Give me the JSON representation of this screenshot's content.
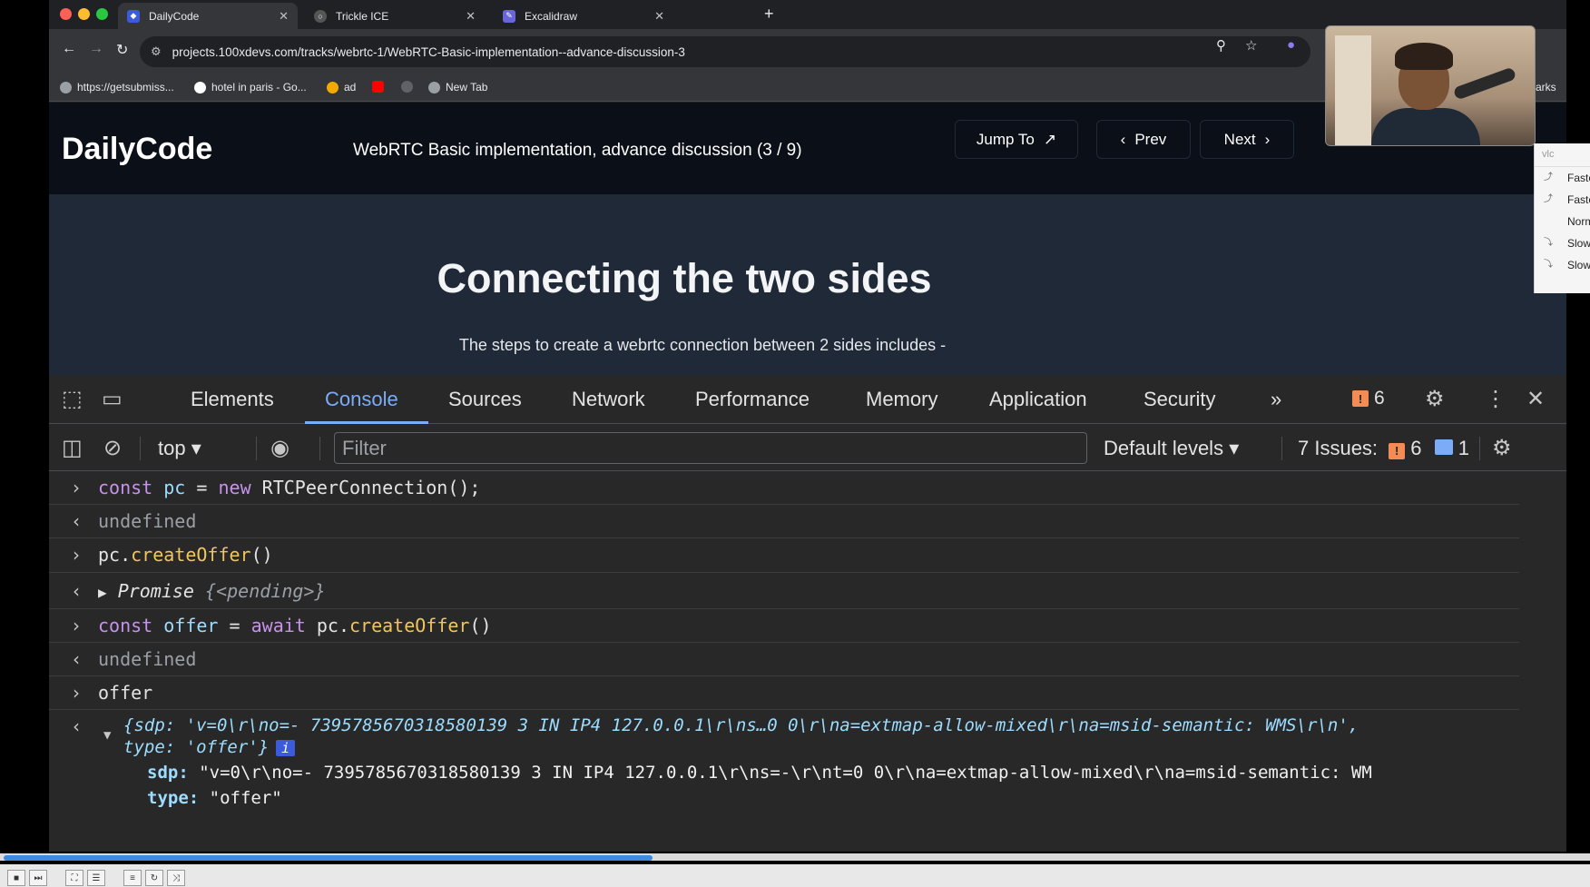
{
  "browser": {
    "tabs": [
      {
        "title": "DailyCode"
      },
      {
        "title": "Trickle ICE"
      },
      {
        "title": "Excalidraw"
      }
    ],
    "url": "projects.100xdevs.com/tracks/webrtc-1/WebRTC-Basic-implementation--advance-discussion-3",
    "bookmarks": [
      {
        "label": "https://getsubmiss..."
      },
      {
        "label": "hotel in paris - Go..."
      },
      {
        "label": "ad"
      },
      {
        "label": "New Tab"
      }
    ],
    "bookmarks_right": "arks"
  },
  "site": {
    "logo": "DailyCode",
    "lesson_title": "WebRTC Basic implementation, advance discussion (3 / 9)",
    "jump_to": "Jump To",
    "prev": "Prev",
    "next": "Next",
    "heading": "Connecting the two sides",
    "paragraph": "The steps to create a webrtc connection between 2 sides includes -"
  },
  "devtools": {
    "tabs": [
      "Elements",
      "Console",
      "Sources",
      "Network",
      "Performance",
      "Memory",
      "Application",
      "Security"
    ],
    "active_tab": "Console",
    "warning_count": "6",
    "context": "top",
    "filter_placeholder": "Filter",
    "levels": "Default levels",
    "issues_label": "7 Issues:",
    "issues_warn": "6",
    "issues_info": "1"
  },
  "console": {
    "l1": {
      "kw": "const",
      "var": "pc",
      "eq": " = ",
      "new": "new",
      "rest": " RTCPeerConnection();"
    },
    "l2": "undefined",
    "l3": {
      "obj": "pc.",
      "fn": "createOffer",
      "rest": "()"
    },
    "l4": {
      "name": "Promise",
      "state": "{<pending>}"
    },
    "l5": {
      "kw": "const",
      "var": "offer",
      "eq": " = ",
      "await": "await",
      "obj": " pc.",
      "fn": "createOffer",
      "rest": "()"
    },
    "l6": "undefined",
    "l7": "offer",
    "l8a": "{sdp: 'v=0\\r\\no=- 7395785670318580139 3 IN IP4 127.0.0.1\\r\\ns…0 0\\r\\na=extmap-allow-mixed\\r\\na=msid-semantic: WMS\\r\\n',",
    "l8b": "type: 'offer'}",
    "info_chip": "i",
    "l9_key": "sdp:",
    "l9_val": " \"v=0\\r\\no=- 7395785670318580139 3 IN IP4 127.0.0.1\\r\\ns=-\\r\\nt=0 0\\r\\na=extmap-allow-mixed\\r\\na=msid-semantic: WM",
    "l10_key": "type:",
    "l10_val": " \"offer\""
  },
  "vlc_menu": {
    "search": "vlc",
    "options": [
      "Faste",
      "Faste",
      "Norm",
      "Slow",
      "Slow"
    ]
  },
  "player": {
    "progress_fraction": 0.41
  }
}
